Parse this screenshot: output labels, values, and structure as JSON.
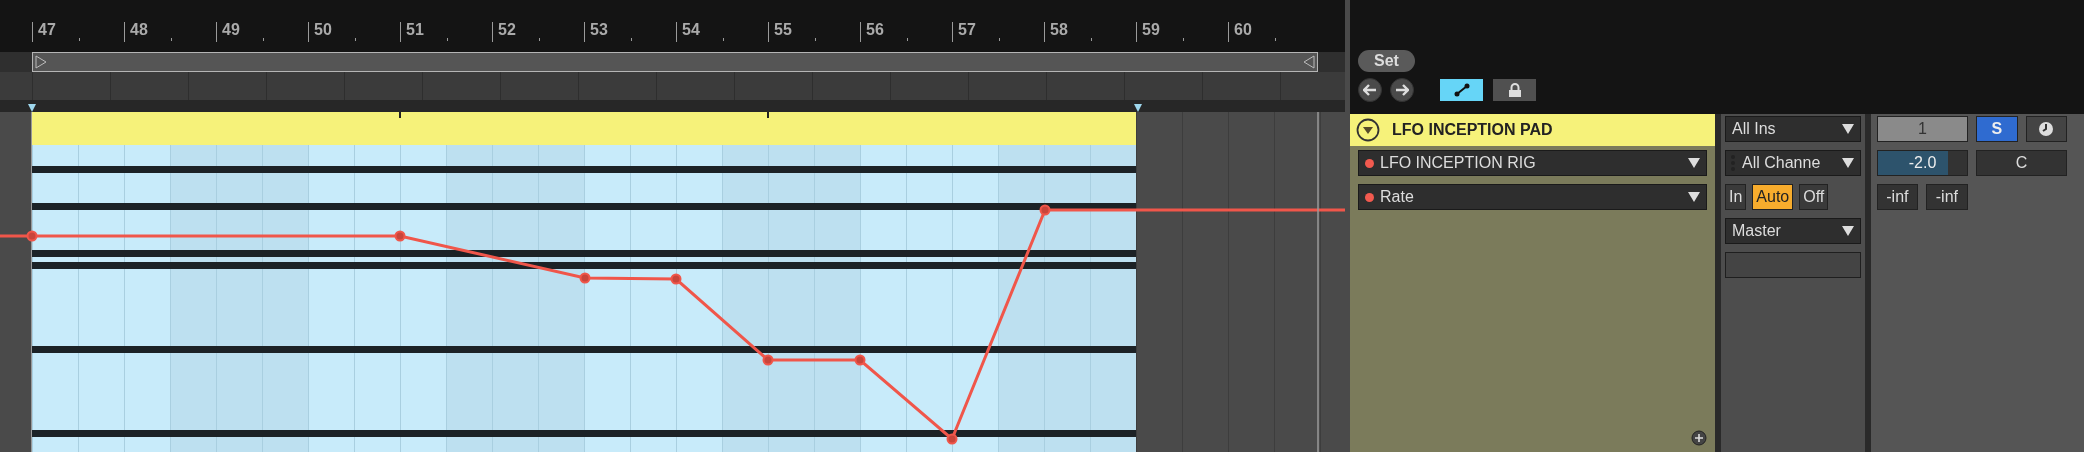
{
  "ruler": {
    "bars": [
      "47",
      "48",
      "49",
      "50",
      "51",
      "52",
      "53",
      "54",
      "55",
      "56",
      "57",
      "58",
      "59",
      "60"
    ]
  },
  "set_button": "Set",
  "automation_button": {
    "on": true
  },
  "lock_button": {
    "on": false
  },
  "track": {
    "name": "LFO INCEPTION PAD",
    "expanded": true,
    "device": "LFO INCEPTION RIG",
    "parameter": "Rate",
    "input_type": "All Ins",
    "input_channel": "All Channe",
    "monitor": [
      {
        "label": "In",
        "selected": false
      },
      {
        "label": "Auto",
        "selected": true
      },
      {
        "label": "Off",
        "selected": false
      }
    ],
    "output": "Master",
    "number": "1",
    "solo": {
      "label": "S",
      "on": true
    },
    "volume": {
      "reading": "-2.0",
      "level": 0.79
    },
    "pan": "C",
    "meters": [
      "-inf",
      "-inf"
    ]
  }
}
